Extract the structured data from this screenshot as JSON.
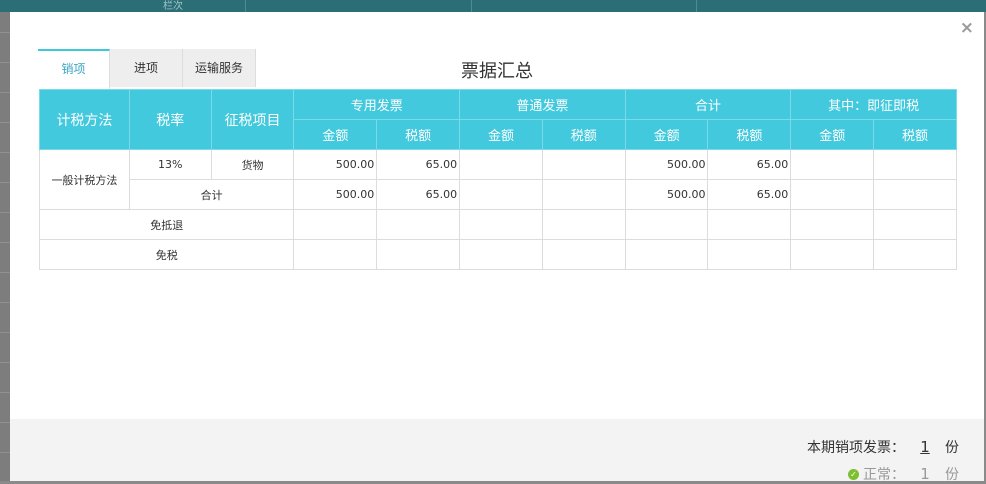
{
  "background": {
    "column_label": "栏次"
  },
  "modal": {
    "close_label": "×",
    "title": "票据汇总",
    "tabs": [
      {
        "label": "销项",
        "active": true
      },
      {
        "label": "进项",
        "active": false
      },
      {
        "label": "运输服务",
        "active": false
      }
    ]
  },
  "table": {
    "headers": {
      "method": "计税方法",
      "rate": "税率",
      "item": "征税项目",
      "special": "专用发票",
      "ordinary": "普通发票",
      "total": "合计",
      "immediate": "其中：即征即税",
      "amount": "金额",
      "tax": "税额"
    },
    "rows": {
      "general_method": "一般计税方法",
      "rate_13": "13%",
      "goods": "货物",
      "special_amount": "500.00",
      "special_tax": "65.00",
      "total_amount": "500.00",
      "total_tax": "65.00",
      "subtotal_label": "合计",
      "subtotal_special_amount": "500.00",
      "subtotal_special_tax": "65.00",
      "subtotal_total_amount": "500.00",
      "subtotal_total_tax": "65.00",
      "exempt_refund": "免抵退",
      "tax_free": "免税"
    }
  },
  "footer": {
    "invoice_label": "本期销项发票：",
    "invoice_count": "1",
    "unit": "份",
    "normal_label": "正常：",
    "normal_count": "1",
    "normal_unit": "份",
    "normal_color": "#7cbf2f"
  }
}
